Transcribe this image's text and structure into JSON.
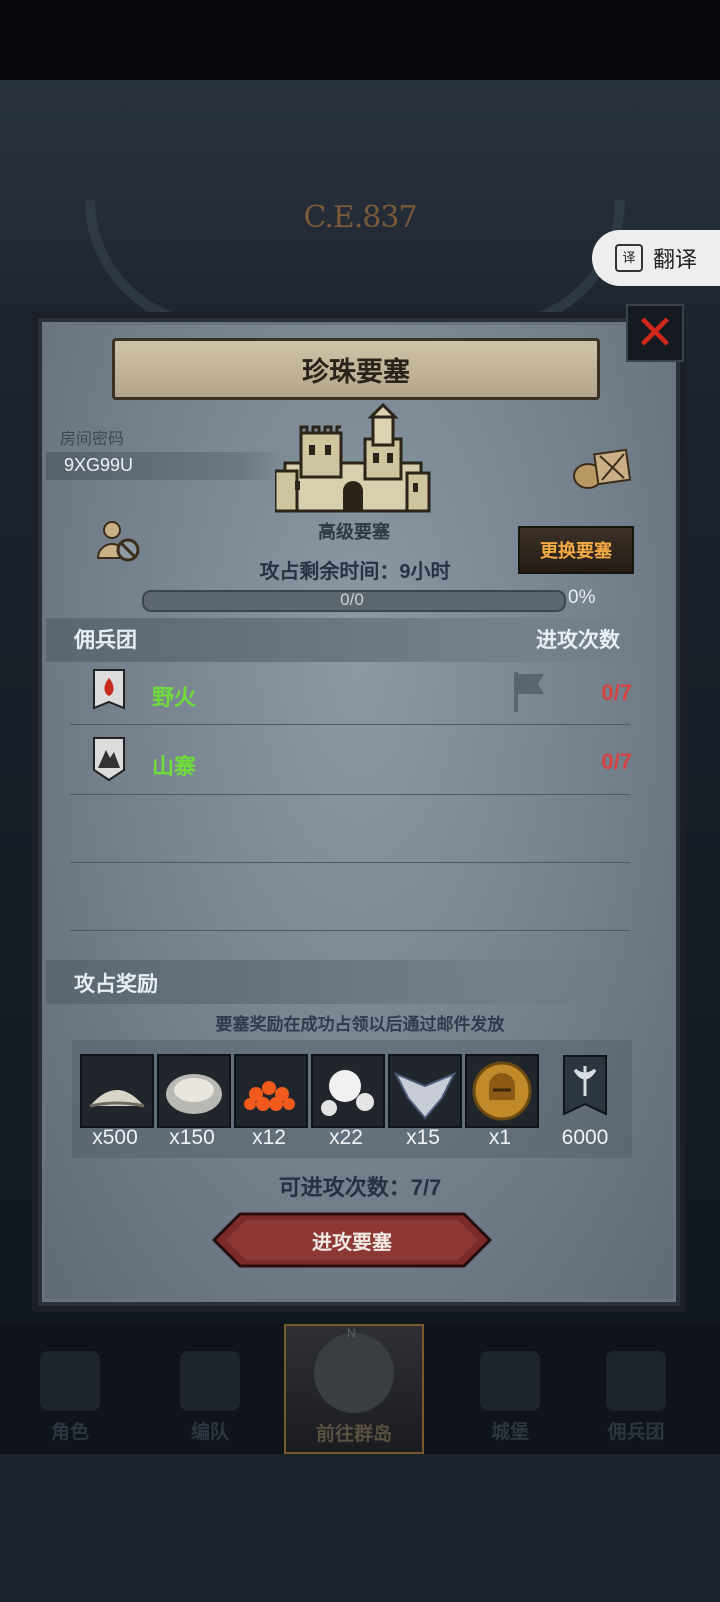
{
  "background": {
    "era_label": "C.E.837"
  },
  "translate": {
    "label": "翻译",
    "icon_glyph": "译"
  },
  "modal": {
    "title": "珍珠要塞",
    "close_glyph": "✕",
    "room": {
      "label": "房间密码",
      "code": "9XG99U"
    },
    "fortress_level": "高级要塞",
    "change_button": "更换要塞",
    "time_remaining": "攻占剩余时间：9小时",
    "progress": {
      "value_text": "0/0",
      "percent_text": "0%",
      "fraction": 0
    },
    "mercenary_section": {
      "title": "佣兵团",
      "count_header": "进攻次数",
      "rows": [
        {
          "name": "野火",
          "count": "0/7",
          "icon": "fire-banner-icon"
        },
        {
          "name": "山寨",
          "count": "0/7",
          "icon": "mountain-banner-icon"
        }
      ]
    },
    "reward_section": {
      "title": "攻占奖励",
      "note": "要塞奖励在成功占领以后通过邮件发放",
      "items": [
        {
          "icon": "salt-pile-icon",
          "qty": "x500"
        },
        {
          "icon": "oyster-icon",
          "qty": "x150"
        },
        {
          "icon": "fish-roe-icon",
          "qty": "x12"
        },
        {
          "icon": "pearl-icon",
          "qty": "x22"
        },
        {
          "icon": "winged-emblem-icon",
          "qty": "x15"
        },
        {
          "icon": "knight-helmet-coin-icon",
          "qty": "x1"
        },
        {
          "icon": "axe-banner-icon",
          "qty": "6000"
        }
      ]
    },
    "attempts_text": "可进攻次数：7/7",
    "attack_button": "进攻要塞"
  },
  "bottom_nav": [
    {
      "label": "角色",
      "icon": "character-icon",
      "active": false
    },
    {
      "label": "编队",
      "icon": "formation-icon",
      "active": false
    },
    {
      "label": "前往群岛",
      "icon": "compass-map-icon",
      "active": true
    },
    {
      "label": "城堡",
      "icon": "castle-icon",
      "active": false
    },
    {
      "label": "佣兵团",
      "icon": "mercenary-ship-icon",
      "active": false
    }
  ],
  "colors": {
    "accent_orange": "#f3a944",
    "merc_name_green": "#6fdc3a",
    "count_red": "#d64242",
    "close_red": "#d0261c"
  }
}
